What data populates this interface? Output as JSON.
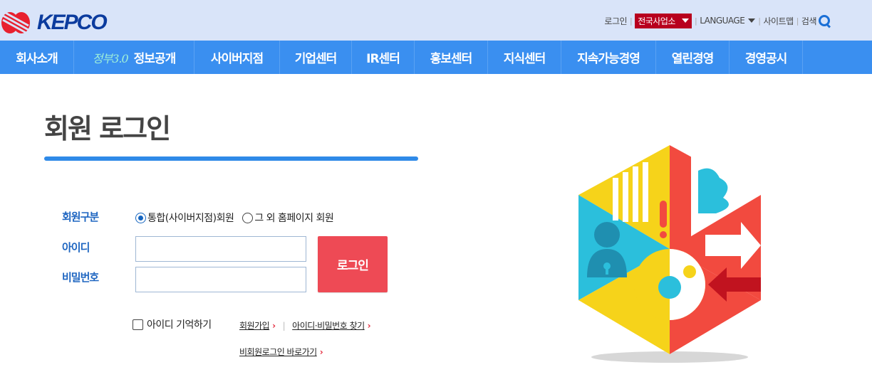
{
  "header": {
    "logo_text": "KEPCO",
    "util": {
      "login": "로그인",
      "regional": "전국사업소",
      "language": "LANGUAGE",
      "sitemap": "사이트맵",
      "search": "검색"
    }
  },
  "nav": {
    "items": [
      {
        "label": "회사소개"
      },
      {
        "badge": "정부3.0",
        "label": "정보공개"
      },
      {
        "label": "사이버지점"
      },
      {
        "label": "기업센터"
      },
      {
        "label": "IR센터"
      },
      {
        "label": "홍보센터"
      },
      {
        "label": "지식센터"
      },
      {
        "label": "지속가능경영"
      },
      {
        "label": "열린경영"
      },
      {
        "label": "경영공시"
      }
    ]
  },
  "main": {
    "title": "회원 로그인",
    "member_type_label": "회원구분",
    "member_type_options": [
      "통합(사이버지점)회원",
      "그 외 홈페이지 회원"
    ],
    "member_type_selected": "통합(사이버지점)회원",
    "id_label": "아이디",
    "id_value": "",
    "password_label": "비밀번호",
    "password_value": "",
    "login_button": "로그인",
    "remember_id": "아이디 기억하기",
    "links": {
      "join": "회원가입",
      "find": "아이디·비밀번호 찾기",
      "guest": "비회원로그인 바로가기"
    }
  },
  "colors": {
    "topbar_bg": "#d9e4f9",
    "nav_bg": "#3a8ff0",
    "accent_blue": "#2f8ae8",
    "login_red": "#ee4a55",
    "regional_red": "#b8001e"
  }
}
